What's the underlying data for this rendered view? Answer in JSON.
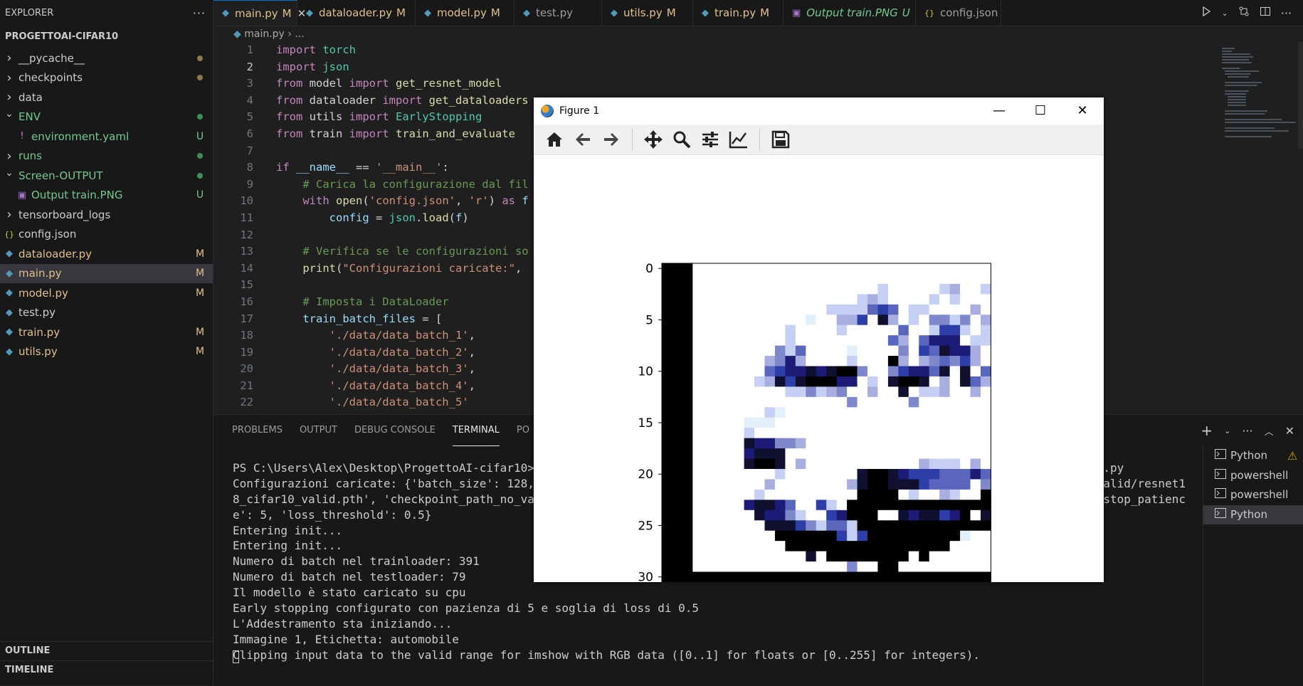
{
  "sidebar": {
    "header": "EXPLORER",
    "more_icon": "ellipsis-icon",
    "project": "PROGETTOAI-CIFAR10",
    "items": [
      {
        "label": "__pycache__",
        "kind": "folder",
        "expanded": false,
        "indent": 0,
        "badge": "dot",
        "color": "#cccccc"
      },
      {
        "label": "checkpoints",
        "kind": "folder",
        "expanded": false,
        "indent": 0,
        "badge": "dot",
        "color": "#cccccc"
      },
      {
        "label": "data",
        "kind": "folder",
        "expanded": false,
        "indent": 0,
        "badge": "",
        "color": "#cccccc"
      },
      {
        "label": "ENV",
        "kind": "folder",
        "expanded": true,
        "indent": 0,
        "badge": "dot-green",
        "color": "#73c991"
      },
      {
        "label": "environment.yaml",
        "kind": "yaml",
        "expanded": false,
        "indent": 1,
        "badge": "U",
        "color": "#73c991"
      },
      {
        "label": "runs",
        "kind": "folder",
        "expanded": false,
        "indent": 0,
        "badge": "dot-green",
        "color": "#73c991"
      },
      {
        "label": "Screen-OUTPUT",
        "kind": "folder",
        "expanded": true,
        "indent": 0,
        "badge": "dot-green",
        "color": "#73c991"
      },
      {
        "label": "Output train.PNG",
        "kind": "image",
        "expanded": false,
        "indent": 1,
        "badge": "U",
        "color": "#73c991"
      },
      {
        "label": "tensorboard_logs",
        "kind": "folder",
        "expanded": false,
        "indent": 0,
        "badge": "",
        "color": "#cccccc"
      },
      {
        "label": "config.json",
        "kind": "json",
        "expanded": false,
        "indent": 0,
        "badge": "",
        "color": "#cccccc"
      },
      {
        "label": "dataloader.py",
        "kind": "py",
        "expanded": false,
        "indent": 0,
        "badge": "M",
        "color": "#e2c08d"
      },
      {
        "label": "main.py",
        "kind": "py",
        "expanded": false,
        "indent": 0,
        "badge": "M",
        "color": "#e2c08d",
        "selected": true
      },
      {
        "label": "model.py",
        "kind": "py",
        "expanded": false,
        "indent": 0,
        "badge": "M",
        "color": "#e2c08d"
      },
      {
        "label": "test.py",
        "kind": "py",
        "expanded": false,
        "indent": 0,
        "badge": "",
        "color": "#cccccc"
      },
      {
        "label": "train.py",
        "kind": "py",
        "expanded": false,
        "indent": 0,
        "badge": "M",
        "color": "#e2c08d"
      },
      {
        "label": "utils.py",
        "kind": "py",
        "expanded": false,
        "indent": 0,
        "badge": "M",
        "color": "#e2c08d"
      }
    ],
    "outline": "OUTLINE",
    "timeline": "TIMELINE"
  },
  "tabs": [
    {
      "label": "main.py",
      "mod": "M",
      "active": true,
      "icon": "python-icon"
    },
    {
      "label": "dataloader.py",
      "mod": "M",
      "active": false,
      "icon": "python-icon"
    },
    {
      "label": "model.py",
      "mod": "M",
      "active": false,
      "icon": "python-icon"
    },
    {
      "label": "test.py",
      "mod": "",
      "active": false,
      "icon": "python-icon"
    },
    {
      "label": "utils.py",
      "mod": "M",
      "active": false,
      "icon": "python-icon"
    },
    {
      "label": "train.py",
      "mod": "M",
      "active": false,
      "icon": "python-icon"
    },
    {
      "label": "Output train.PNG",
      "mod": "U",
      "active": false,
      "icon": "image-icon"
    },
    {
      "label": "config.json",
      "mod": "",
      "active": false,
      "icon": "json-icon"
    }
  ],
  "breadcrumb": {
    "file": "main.py",
    "sep": "›",
    "rest": "..."
  },
  "editor": {
    "current_line": 2,
    "lines": [
      [
        [
          "kw",
          "import"
        ],
        [
          "t",
          " "
        ],
        [
          "cls",
          "torch"
        ]
      ],
      [
        [
          "kw",
          "import"
        ],
        [
          "t",
          " "
        ],
        [
          "cls",
          "json"
        ]
      ],
      [
        [
          "kw",
          "from"
        ],
        [
          "t",
          " model "
        ],
        [
          "kw",
          "import"
        ],
        [
          "t",
          " "
        ],
        [
          "fn",
          "get_resnet_model"
        ]
      ],
      [
        [
          "kw",
          "from"
        ],
        [
          "t",
          " dataloader "
        ],
        [
          "kw",
          "import"
        ],
        [
          "t",
          " "
        ],
        [
          "fn",
          "get_dataloaders"
        ]
      ],
      [
        [
          "kw",
          "from"
        ],
        [
          "t",
          " utils "
        ],
        [
          "kw",
          "import"
        ],
        [
          "t",
          " "
        ],
        [
          "cls",
          "EarlyStopping"
        ]
      ],
      [
        [
          "kw",
          "from"
        ],
        [
          "t",
          " train "
        ],
        [
          "kw",
          "import"
        ],
        [
          "t",
          " "
        ],
        [
          "fn",
          "train_and_evaluate"
        ]
      ],
      [],
      [
        [
          "kw",
          "if"
        ],
        [
          "t",
          " "
        ],
        [
          "var",
          "__name__"
        ],
        [
          "t",
          " == "
        ],
        [
          "str",
          "'__main__'"
        ],
        [
          "t",
          ":"
        ]
      ],
      [
        [
          "t",
          "    "
        ],
        [
          "cm",
          "# Carica la configurazione dal fil"
        ]
      ],
      [
        [
          "t",
          "    "
        ],
        [
          "kw",
          "with"
        ],
        [
          "t",
          " "
        ],
        [
          "fn",
          "open"
        ],
        [
          "t",
          "("
        ],
        [
          "str",
          "'config.json'"
        ],
        [
          "t",
          ", "
        ],
        [
          "str",
          "'r'"
        ],
        [
          "t",
          ") "
        ],
        [
          "kw",
          "as"
        ],
        [
          "t",
          " "
        ],
        [
          "var",
          "f"
        ]
      ],
      [
        [
          "t",
          "        "
        ],
        [
          "var",
          "config"
        ],
        [
          "t",
          " = "
        ],
        [
          "cls",
          "json"
        ],
        [
          "t",
          "."
        ],
        [
          "fn",
          "load"
        ],
        [
          "t",
          "("
        ],
        [
          "var",
          "f"
        ],
        [
          "t",
          ")"
        ]
      ],
      [],
      [
        [
          "t",
          "    "
        ],
        [
          "cm",
          "# Verifica se le configurazioni so"
        ]
      ],
      [
        [
          "t",
          "    "
        ],
        [
          "fn",
          "print"
        ],
        [
          "t",
          "("
        ],
        [
          "str",
          "\"Configurazioni caricate:\""
        ],
        [
          "t",
          ", "
        ]
      ],
      [],
      [
        [
          "t",
          "    "
        ],
        [
          "cm",
          "# Imposta i DataLoader"
        ]
      ],
      [
        [
          "t",
          "    "
        ],
        [
          "var",
          "train_batch_files"
        ],
        [
          "t",
          " = ["
        ]
      ],
      [
        [
          "t",
          "        "
        ],
        [
          "str",
          "'./data/data_batch_1'"
        ],
        [
          "t",
          ","
        ]
      ],
      [
        [
          "t",
          "        "
        ],
        [
          "str",
          "'./data/data_batch_2'"
        ],
        [
          "t",
          ","
        ]
      ],
      [
        [
          "t",
          "        "
        ],
        [
          "str",
          "'./data/data_batch_3'"
        ],
        [
          "t",
          ","
        ]
      ],
      [
        [
          "t",
          "        "
        ],
        [
          "str",
          "'./data/data_batch_4'"
        ],
        [
          "t",
          ","
        ]
      ],
      [
        [
          "t",
          "        "
        ],
        [
          "str",
          "'./data/data_batch_5'"
        ]
      ]
    ]
  },
  "panel": {
    "tabs": [
      "PROBLEMS",
      "OUTPUT",
      "DEBUG CONSOLE",
      "TERMINAL",
      "PO"
    ],
    "active_tab": "TERMINAL",
    "terminal_lines": [
      "PS C:\\Users\\Alex\\Desktop\\ProgettoAI-cifar10>                                                                                   .py",
      "Configurazioni caricate: {'batch_size': 128,                                                                                  valid/resnet1",
      "8_cifar10_valid.pth', 'checkpoint_path_no_va                                                                                  _stop_patienc",
      "e': 5, 'loss_threshold': 0.5}",
      "Entering init...",
      "Entering init...",
      "Numero di batch nel trainloader: 391",
      "Numero di batch nel testloader: 79",
      "Il modello è stato caricato su cpu",
      "Early stopping configurato con pazienza di 5 e soglia di loss di 0.5",
      "L'Addestramento sta iniziando...",
      "Immagine 1, Etichetta: automobile",
      "Clipping input data to the valid range for imshow with RGB data ([0..1] for floats or [0..255] for integers).",
      ""
    ],
    "terminals": [
      {
        "label": "Python",
        "warn": true,
        "active": false
      },
      {
        "label": "powershell",
        "warn": false,
        "active": false
      },
      {
        "label": "powershell",
        "warn": false,
        "active": false
      },
      {
        "label": "Python",
        "warn": false,
        "active": true
      }
    ]
  },
  "figure": {
    "title": "Figure 1",
    "toolbar": [
      "home-icon",
      "back-icon",
      "forward-icon",
      "pan-icon",
      "zoom-icon",
      "configure-subplots-icon",
      "edit-axis-icon",
      "save-icon"
    ],
    "chart_data": {
      "type": "heatmap",
      "title": "",
      "xlabel": "",
      "ylabel": "",
      "xlim": [
        -0.5,
        31.5
      ],
      "ylim": [
        31.5,
        -0.5
      ],
      "xticks": [
        0,
        5,
        10,
        15,
        20,
        25,
        30
      ],
      "yticks": [
        0,
        5,
        10,
        15,
        20,
        25,
        30
      ],
      "size": [
        32,
        32
      ],
      "palette": {
        ".": "#ffffff",
        "0": "#000000",
        "1": "#101030",
        "2": "#1c1c78",
        "3": "#2e3ea8",
        "4": "#5a66be",
        "5": "#8088cc",
        "6": "#a8aee0",
        "7": "#c6d0f4",
        "8": "#e2f0fc"
      },
      "rows": [
        "000.............................",
        "000.............................",
        "000..................7.....76..7",
        "000................767....7.7...",
        "000.............7777434.77....6.",
        "000...........8..663.16.7.5575.6",
        "000.........7....7.....4..7337.7",
        "000.........7.........46.4222.77",
        "000........574....8....5.341226.",
        "000.......6526....7...06.654536.",
        "000.......4322121005..532241.1.4",
        "000......7613100022.7.1001.6.146",
        "000.........775765..6..1.776..6.",
        "000...............5.....5.......",
        "000.......78....................",
        "000.....888.....................",
        "000.....7.........................",
        "000.....122556..................",
        "000.....2111....................",
        "000.....1001.6...........6777.6.",
        "000........7.......1001233344424",
        "000.......6.......610011134444.5",
        "000......7.........0000.7..67..0",
        "000.....21124..37.00000000000000",
        "000......12257..32000..1211320.1",
        "000.......1113574470000000000000",
        "000........0000003730000000008..",
        "000.........0000000000000000....",
        "000...........1.00000000.0......",
        "000...............5..00........",
        "00000000000000000000000000000000",
        "00000000000000000000000000000000"
      ]
    }
  },
  "colors": {
    "accent": "#0078d4",
    "modified": "#e2c08d",
    "untracked": "#73c991",
    "warning": "#cca700"
  }
}
